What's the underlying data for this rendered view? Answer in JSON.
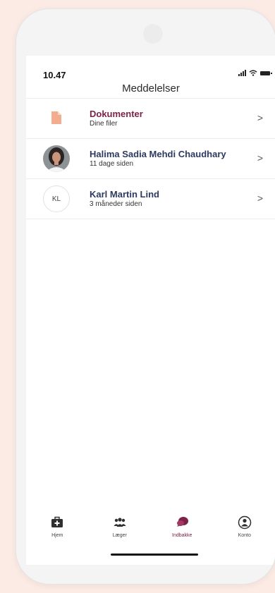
{
  "status_bar": {
    "time": "10.47"
  },
  "header": {
    "title": "Meddelelser"
  },
  "messages": [
    {
      "kind": "documents",
      "title": "Dokumenter",
      "subtitle": "Dine filer",
      "icon": "document-icon"
    },
    {
      "kind": "conversation",
      "title": "Halima Sadia Mehdi Chaudhary",
      "subtitle": "11 dage siden",
      "avatar": "photo"
    },
    {
      "kind": "conversation",
      "title": "Karl Martin Lind",
      "subtitle": "3 måneder siden",
      "initials": "KL"
    }
  ],
  "tabbar": {
    "items": [
      {
        "label": "Hjem",
        "icon": "medical-kit-icon",
        "active": false
      },
      {
        "label": "Læger",
        "icon": "doctors-icon",
        "active": false
      },
      {
        "label": "Indbakke",
        "icon": "chat-bubbles-icon",
        "active": true
      },
      {
        "label": "Konto",
        "icon": "account-icon",
        "active": false
      }
    ]
  },
  "colors": {
    "background": "#fcebe5",
    "accent": "#7d2148",
    "name_text": "#2d3a60",
    "document_icon": "#f3ad8e"
  }
}
